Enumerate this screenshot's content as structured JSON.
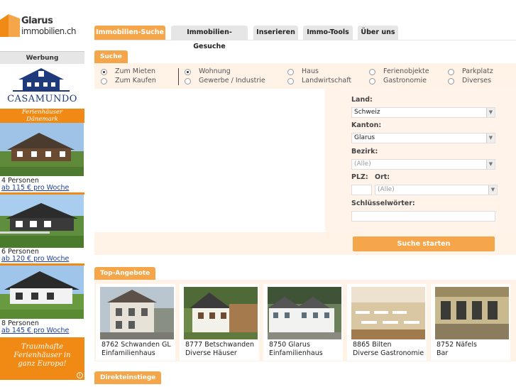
{
  "logo": {
    "line1": "Glarus",
    "line2": "immobilien.ch"
  },
  "sidebar": {
    "werbung": "Werbung",
    "ad": {
      "brand": "CASAMUNDO",
      "tag_line1": "Ferienhäuser",
      "tag_line2": "Dänemark",
      "offers": [
        {
          "persons": "4 Personen",
          "price": "ab 115 € pro Woche"
        },
        {
          "persons": "6 Personen",
          "price": "ab 120 € pro Woche"
        },
        {
          "persons": "8 Personen",
          "price": "ab 145 € pro Woche"
        }
      ],
      "slogan_1": "Traumhafte",
      "slogan_2": "Ferienhäuser in",
      "slogan_3": "ganz Europa!",
      "info": "i"
    }
  },
  "nav": {
    "tabs": [
      {
        "label": "Immobilien-Suche",
        "active": true
      },
      {
        "label": "Immobilien-Gesuche",
        "active": false
      },
      {
        "label": "Inserieren",
        "active": false
      },
      {
        "label": "Immo-Tools",
        "active": false
      },
      {
        "label": "Über uns",
        "active": false
      }
    ]
  },
  "search": {
    "tab": "Suche",
    "mode": {
      "mieten": "Zum Mieten",
      "kaufen": "Zum Kaufen",
      "selected": "mieten"
    },
    "categories": [
      {
        "label": "Wohnung",
        "checked": true
      },
      {
        "label": "Gewerbe / Industrie",
        "checked": false
      },
      {
        "label": "Haus",
        "checked": false
      },
      {
        "label": "Landwirtschaft",
        "checked": false
      },
      {
        "label": "Ferienobjekte",
        "checked": false
      },
      {
        "label": "Gastronomie",
        "checked": false
      },
      {
        "label": "Parkplatz",
        "checked": false
      },
      {
        "label": "Diverses",
        "checked": false
      }
    ],
    "form": {
      "land_label": "Land:",
      "land_value": "Schweiz",
      "kanton_label": "Kanton:",
      "kanton_value": "Glarus",
      "bezirk_label": "Bezirk:",
      "bezirk_value": "(Alle)",
      "plz_label": "PLZ:",
      "ort_label": "Ort:",
      "ort_value": "(Alle)",
      "keywords_label": "Schlüsselwörter:",
      "plz_value": "",
      "keywords_value": ""
    },
    "button": "Suche starten"
  },
  "top": {
    "tab": "Top-Angebote",
    "items": [
      {
        "place": "8762 Schwanden GL",
        "type": "Einfamilienhaus"
      },
      {
        "place": "8777 Betschwanden",
        "type": "Diverse Häuser"
      },
      {
        "place": "8750 Glarus",
        "type": "Einfamilienhaus"
      },
      {
        "place": "8865 Bilten",
        "type": "Diverse Gastronomie"
      },
      {
        "place": "8752 Näfels",
        "type": "Bar"
      }
    ]
  },
  "direkt": {
    "tab": "Direkteinstiege"
  }
}
